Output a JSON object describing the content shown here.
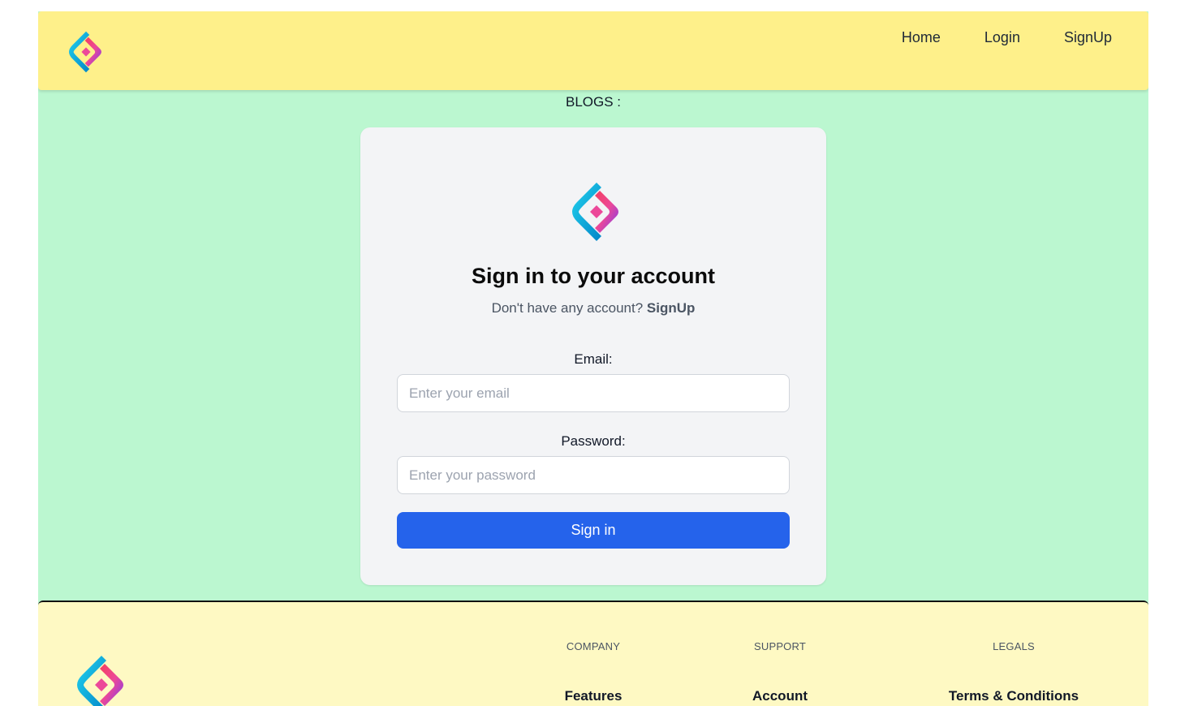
{
  "navbar": {
    "logo_icon": "brand-diamond-logo",
    "links": [
      "Home",
      "Login",
      "SignUp"
    ]
  },
  "page": {
    "blogs_heading": "BLOGS :"
  },
  "signin": {
    "logo_icon": "brand-diamond-logo",
    "title": "Sign in to your account",
    "subtitle_prefix": "Don't have any account?",
    "subtitle_link": "SignUp",
    "email_label": "Email:",
    "email_placeholder": "Enter your email",
    "email_value": "",
    "password_label": "Password:",
    "password_placeholder": "Enter your password",
    "password_value": "",
    "submit_label": "Sign in"
  },
  "footer": {
    "logo_icon": "brand-diamond-logo",
    "columns": [
      {
        "heading": "COMPANY",
        "first_link": "Features"
      },
      {
        "heading": "SUPPORT",
        "first_link": "Account"
      },
      {
        "heading": "LEGALS",
        "first_link": "Terms & Conditions"
      }
    ]
  },
  "colors": {
    "navbar_bg": "#fef08a",
    "page_bg": "#bbf7d0",
    "card_bg": "#f3f4f6",
    "button_bg": "#2563eb",
    "footer_bg": "#fef9c3",
    "logo_cyan": "#0ea5e9",
    "logo_pink": "#ec4899",
    "logo_purple": "#8b5cf6"
  }
}
